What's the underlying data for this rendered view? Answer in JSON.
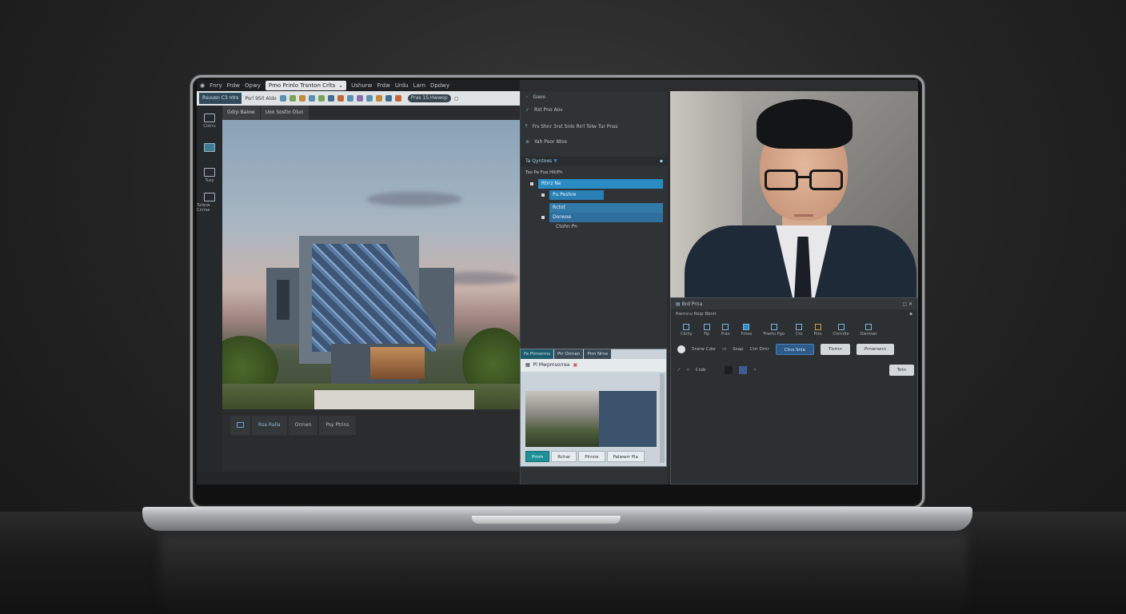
{
  "left_app": {
    "menu": [
      "Fnry",
      "Frdw",
      "Opwy"
    ],
    "menu_tab_selected": "Pmo Prinlo Trsnton Crlts",
    "menu_right": [
      "Ushurw",
      "Frdw",
      "Urdu",
      "Larn",
      "Dpdwy"
    ],
    "toolbar_tab": "Rsuusn C3 ntrs",
    "toolbar_title": "Psrl 9S0 Aldo",
    "toolbar_search": "Pras 1S.Hwwop",
    "sidebar": [
      {
        "label": "Cotrrs"
      },
      {
        "label": ""
      },
      {
        "label": "Tusy"
      },
      {
        "label": "Tutarw Cnrrse"
      }
    ],
    "subtabs": [
      "Gdrp Balow",
      "Uoo Sostlo Olun"
    ],
    "bottom_tabs": [
      "Rsa Ralla",
      "Orrnen",
      "Psy Ptrins"
    ]
  },
  "mid_panel": {
    "rows": [
      "Gaoo",
      "Rst Pno Aov",
      "Frs Shnr 3rst Snlo Rrrl Tolw Tur Pnss",
      "Yah Poor Ntos"
    ],
    "tree_head": "Ta Qyntoes",
    "tree_sub": "Tso Pa Fuo Hlt/Ph",
    "tree_rows": [
      "Rtrrz Ne",
      "Pu Peshre",
      "Rctot",
      "Dorwoe",
      "Ctohn Pn"
    ]
  },
  "float_window": {
    "tabs": [
      "Fa Ptrnorrns",
      "Ptr Orrnen",
      "Prm Nrno"
    ],
    "tools_text": "Pl Mwpmsorrea",
    "buttons": [
      "Prnm",
      "Rchar",
      "Plrnne",
      "Palwwrr Pla"
    ]
  },
  "right_panel": {
    "props_title": "Brd Prna",
    "props_sub": "Rwrnnu Roip Bbnlr",
    "icons": [
      "Cbrhy",
      "Fip",
      "Frao",
      "Fmoo",
      "Frwrtu Pgo",
      "Cro",
      "Ptro",
      "Chrrnlto",
      "Dwrmwr"
    ],
    "ctrl_labels": [
      "Srarw Cdsr",
      "Ssap",
      "Ctrr Drnr"
    ],
    "ctrl_buttons": [
      "Ctns Snla",
      "Tlcrnn",
      "Prnwrwnn"
    ],
    "ctrl2_label": "Crob",
    "ctrl2_button": "Totn"
  },
  "colors": {
    "accent_blue": "#2a8cc4",
    "teal_button": "#1f8f98",
    "toolbar_bg": "#dfe3e6"
  }
}
